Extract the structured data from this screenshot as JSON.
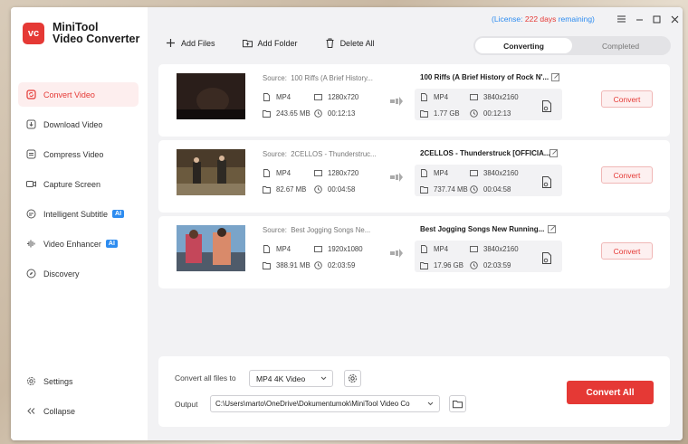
{
  "app": {
    "logo_initials": "vc",
    "name_line1": "MiniTool",
    "name_line2": "Video Converter"
  },
  "sidebar": {
    "items": [
      {
        "label": "Convert Video",
        "icon": "convert-icon",
        "active": true
      },
      {
        "label": "Download Video",
        "icon": "download-icon"
      },
      {
        "label": "Compress Video",
        "icon": "compress-icon"
      },
      {
        "label": "Capture Screen",
        "icon": "camera-icon"
      },
      {
        "label": "Intelligent Subtitle",
        "icon": "subtitle-icon",
        "badge": "AI"
      },
      {
        "label": "Video Enhancer",
        "icon": "enhancer-icon",
        "badge": "AI"
      },
      {
        "label": "Discovery",
        "icon": "compass-icon"
      }
    ],
    "settings_label": "Settings",
    "collapse_label": "Collapse"
  },
  "header": {
    "license_prefix": "(License: ",
    "license_days": "222 days",
    "license_suffix": " remaining)"
  },
  "toolbar": {
    "add_files": "Add Files",
    "add_folder": "Add Folder",
    "delete_all": "Delete All"
  },
  "tabs": {
    "converting": "Converting",
    "completed": "Completed"
  },
  "files": [
    {
      "source_label": "Source:",
      "source_title": "100 Riffs (A Brief History...",
      "src_format": "MP4",
      "src_resolution": "1280x720",
      "src_size": "243.65 MB",
      "src_duration": "00:12:13",
      "target_title": "100 Riffs (A Brief History of Rock N'...",
      "dst_format": "MP4",
      "dst_resolution": "3840x2160",
      "dst_size": "1.77 GB",
      "dst_duration": "00:12:13",
      "convert_label": "Convert"
    },
    {
      "source_label": "Source:",
      "source_title": "2CELLOS - Thunderstruc...",
      "src_format": "MP4",
      "src_resolution": "1280x720",
      "src_size": "82.67 MB",
      "src_duration": "00:04:58",
      "target_title": "2CELLOS - Thunderstruck [OFFICIA...",
      "dst_format": "MP4",
      "dst_resolution": "3840x2160",
      "dst_size": "737.74 MB",
      "dst_duration": "00:04:58",
      "convert_label": "Convert"
    },
    {
      "source_label": "Source:",
      "source_title": "Best Jogging Songs Ne...",
      "src_format": "MP4",
      "src_resolution": "1920x1080",
      "src_size": "388.91 MB",
      "src_duration": "02:03:59",
      "target_title": "Best Jogging Songs New Running...",
      "dst_format": "MP4",
      "dst_resolution": "3840x2160",
      "dst_size": "17.96 GB",
      "dst_duration": "02:03:59",
      "convert_label": "Convert"
    }
  ],
  "bottom": {
    "convert_all_to_label": "Convert all files to",
    "format_value": "MP4 4K Video",
    "output_label": "Output",
    "output_path": "C:\\Users\\marto\\OneDrive\\Dokumentumok\\MiniTool Video Co",
    "convert_all_button": "Convert All"
  },
  "colors": {
    "accent": "#e53935",
    "link": "#2d8cf0"
  }
}
